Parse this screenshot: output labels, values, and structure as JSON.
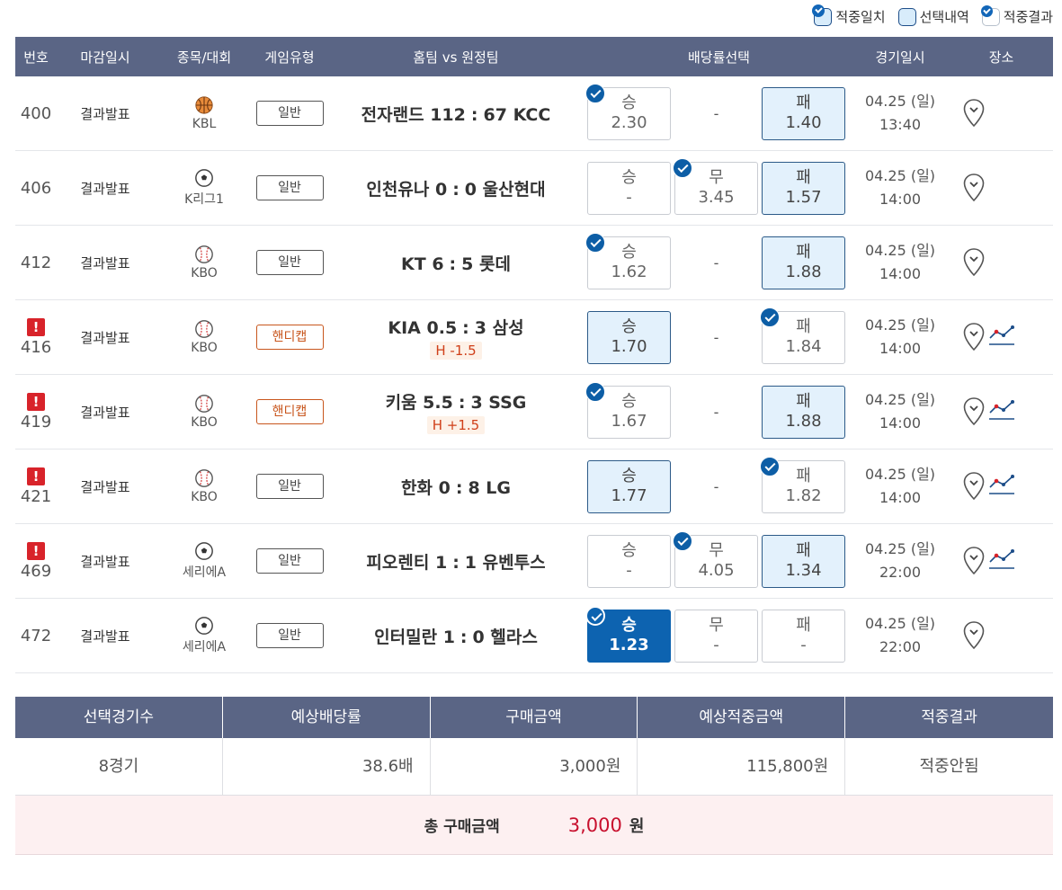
{
  "legend": {
    "items": [
      {
        "label": "적중일치"
      },
      {
        "label": "선택내역"
      },
      {
        "label": "적중결과"
      }
    ]
  },
  "table": {
    "headers": {
      "no": "번호",
      "deadline": "마감일시",
      "sport": "종목/대회",
      "type": "게임유형",
      "teams": "홈팀 vs 원정팀",
      "odds": "배당률선택",
      "date": "경기일시",
      "place": "장소"
    },
    "rows": [
      {
        "no": "400",
        "deadline": "결과발표",
        "league": "KBL",
        "sport_icon": "basketball-icon",
        "type": "일반",
        "home": "전자랜드",
        "home_score": "112",
        "away_score": "67",
        "away": "KCC",
        "handicap": "",
        "win_label": "승",
        "win_odds": "2.30",
        "draw_label": "",
        "draw_odds": "-",
        "lose_label": "패",
        "lose_odds": "1.40",
        "date": "04.25 (일)",
        "time": "13:40"
      },
      {
        "no": "406",
        "deadline": "결과발표",
        "league": "K리그1",
        "sport_icon": "soccer-ball-icon",
        "type": "일반",
        "home": "인천유나",
        "home_score": "0",
        "away_score": "0",
        "away": "울산현대",
        "handicap": "",
        "win_label": "승",
        "win_odds": "-",
        "draw_label": "무",
        "draw_odds": "3.45",
        "lose_label": "패",
        "lose_odds": "1.57",
        "date": "04.25 (일)",
        "time": "14:00"
      },
      {
        "no": "412",
        "deadline": "결과발표",
        "league": "KBO",
        "sport_icon": "baseball-icon",
        "type": "일반",
        "home": "KT",
        "home_score": "6",
        "away_score": "5",
        "away": "롯데",
        "handicap": "",
        "win_label": "승",
        "win_odds": "1.62",
        "draw_label": "",
        "draw_odds": "-",
        "lose_label": "패",
        "lose_odds": "1.88",
        "date": "04.25 (일)",
        "time": "14:00"
      },
      {
        "no": "416",
        "deadline": "결과발표",
        "league": "KBO",
        "sport_icon": "baseball-icon",
        "type": "핸디캡",
        "home": "KIA",
        "home_score": "0.5",
        "away_score": "3",
        "away": "삼성",
        "handicap": "H -1.5",
        "win_label": "승",
        "win_odds": "1.70",
        "draw_label": "",
        "draw_odds": "-",
        "lose_label": "패",
        "lose_odds": "1.84",
        "date": "04.25 (일)",
        "time": "14:00"
      },
      {
        "no": "419",
        "deadline": "결과발표",
        "league": "KBO",
        "sport_icon": "baseball-icon",
        "type": "핸디캡",
        "home": "키움",
        "home_score": "5.5",
        "away_score": "3",
        "away": "SSG",
        "handicap": "H +1.5",
        "win_label": "승",
        "win_odds": "1.67",
        "draw_label": "",
        "draw_odds": "-",
        "lose_label": "패",
        "lose_odds": "1.88",
        "date": "04.25 (일)",
        "time": "14:00"
      },
      {
        "no": "421",
        "deadline": "결과발표",
        "league": "KBO",
        "sport_icon": "baseball-icon",
        "type": "일반",
        "home": "한화",
        "home_score": "0",
        "away_score": "8",
        "away": "LG",
        "handicap": "",
        "win_label": "승",
        "win_odds": "1.77",
        "draw_label": "",
        "draw_odds": "-",
        "lose_label": "패",
        "lose_odds": "1.82",
        "date": "04.25 (일)",
        "time": "14:00"
      },
      {
        "no": "469",
        "deadline": "결과발표",
        "league": "세리에A",
        "sport_icon": "soccer-ball-icon",
        "type": "일반",
        "home": "피오렌티",
        "home_score": "1",
        "away_score": "1",
        "away": "유벤투스",
        "handicap": "",
        "win_label": "승",
        "win_odds": "-",
        "draw_label": "무",
        "draw_odds": "4.05",
        "lose_label": "패",
        "lose_odds": "1.34",
        "date": "04.25 (일)",
        "time": "22:00"
      },
      {
        "no": "472",
        "deadline": "결과발표",
        "league": "세리에A",
        "sport_icon": "soccer-ball-icon",
        "type": "일반",
        "home": "인터밀란",
        "home_score": "1",
        "away_score": "0",
        "away": "헬라스",
        "handicap": "",
        "win_label": "승",
        "win_odds": "1.23",
        "draw_label": "무",
        "draw_odds": "-",
        "lose_label": "패",
        "lose_odds": "-",
        "date": "04.25 (일)",
        "time": "22:00"
      }
    ]
  },
  "summary": {
    "headers": [
      "선택경기수",
      "예상배당률",
      "구매금액",
      "예상적중금액",
      "적중결과"
    ],
    "values": [
      "8경기",
      "38.6배",
      "3,000원",
      "115,800원",
      "적중안됨"
    ],
    "total_label": "총 구매금액",
    "total_value": "3,000",
    "total_unit": "원"
  },
  "colors": {
    "header_bg": "#5a6585",
    "selected_bg": "#0d63b0",
    "result_bg": "#e3f1fc",
    "total_value": "#c8102e",
    "warning": "#d8232a"
  }
}
